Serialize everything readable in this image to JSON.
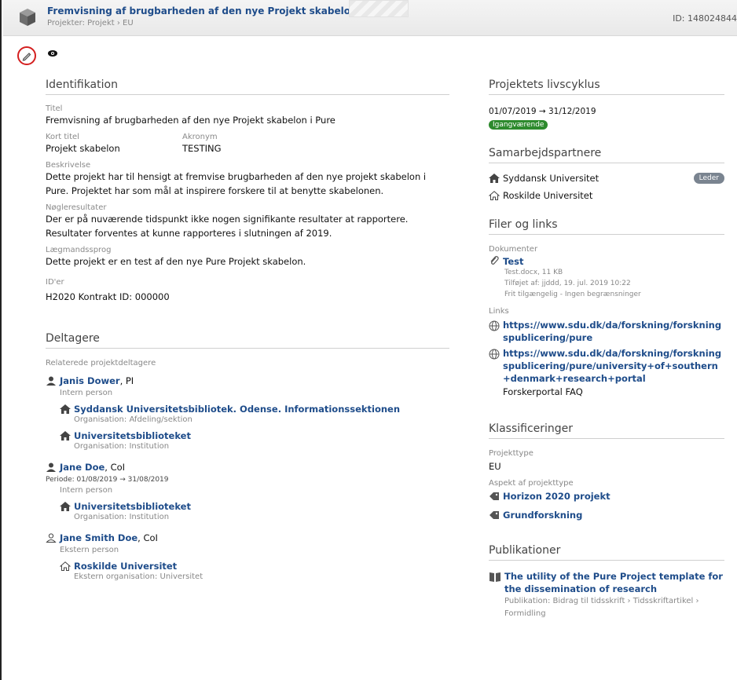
{
  "header": {
    "title": "Fremvisning af brugbarheden af den nye Projekt skabelon i Pure",
    "breadcrumb": "Projekter: Projekt › EU",
    "id": "ID: 148024844"
  },
  "identifikation": {
    "heading": "Identifikation",
    "titel_label": "Titel",
    "titel": "Fremvisning af brugbarheden af den nye Projekt skabelon i Pure",
    "kort_titel_label": "Kort titel",
    "kort_titel": "Projekt skabelon",
    "akronym_label": "Akronym",
    "akronym": "TESTING",
    "beskrivelse_label": "Beskrivelse",
    "beskrivelse": "Dette projekt har til hensigt at fremvise brugbarheden af den nye projekt skabelon i Pure. Projektet har som mål at inspirere forskere til at benytte skabelonen.",
    "noegle_label": "Nøgleresultater",
    "noegle": "Der er på nuværende tidspunkt ikke nogen signifikante resultater at rapportere. Resultater forventes at kunne rapporteres i slutningen af 2019.",
    "laegmand_label": "Lægmandssprog",
    "laegmand": "Dette projekt er en test af den nye Pure Projekt skabelon.",
    "ider_label": "ID'er",
    "ider": "H2020 Kontrakt ID: 000000"
  },
  "deltagere": {
    "heading": "Deltagere",
    "sub": "Relaterede projektdeltagere",
    "p1": {
      "name": "Janis Dower",
      "role": ", PI",
      "type": "Intern person",
      "org_name": "Syddansk Universitetsbibliotek. Odense. Informationssektionen",
      "org_type": "Organisation: Afdeling/sektion",
      "org2_name": "Universitetsbiblioteket",
      "org2_type": "Organisation: Institution"
    },
    "p2": {
      "name": "Jane Doe",
      "role": ", CoI",
      "period": "Periode: 01/08/2019 → 31/08/2019",
      "type": "Intern person",
      "org_name": "Universitetsbiblioteket",
      "org_type": "Organisation: Institution"
    },
    "p3": {
      "name": "Jane Smith Doe",
      "role": ", CoI",
      "type": "Ekstern person",
      "org_name": "Roskilde Universitet",
      "org_type": "Ekstern organisation: Universitet"
    }
  },
  "livscyklus": {
    "heading": "Projektets livscyklus",
    "dates": "01/07/2019 → 31/12/2019",
    "status": "Igangværende",
    "status_color": "#2d8a2d"
  },
  "partnere": {
    "heading": "Samarbejdspartnere",
    "p1": "Syddansk Universitet",
    "p1_badge": "Leder",
    "p2": "Roskilde Universitet"
  },
  "filer": {
    "heading": "Filer og links",
    "dok_label": "Dokumenter",
    "doc_name": "Test",
    "doc_meta1": "Test.docx, 11 KB",
    "doc_meta2": "Tilføjet af: jjddd, 19. jul. 2019 10:22",
    "doc_meta3": "Frit tilgængelig - Ingen begrænsninger",
    "links_label": "Links",
    "link1": "https://www.sdu.dk/da/forskning/forskningspublicering/pure",
    "link2": "https://www.sdu.dk/da/forskning/forskningspublicering/pure/university+of+southern+denmark+research+portal",
    "link2_desc": "Forskerportal FAQ"
  },
  "klass": {
    "heading": "Klassificeringer",
    "type_label": "Projekttype",
    "type": "EU",
    "aspekt_label": "Aspekt af projekttype",
    "tag1": "Horizon 2020 projekt",
    "tag2": "Grundforskning"
  },
  "publ": {
    "heading": "Publikationer",
    "title": "The utility of the Pure Project template for the dissemination of research",
    "meta": "Publikation: Bidrag til tidsskrift › Tidsskriftartikel › Formidling"
  }
}
